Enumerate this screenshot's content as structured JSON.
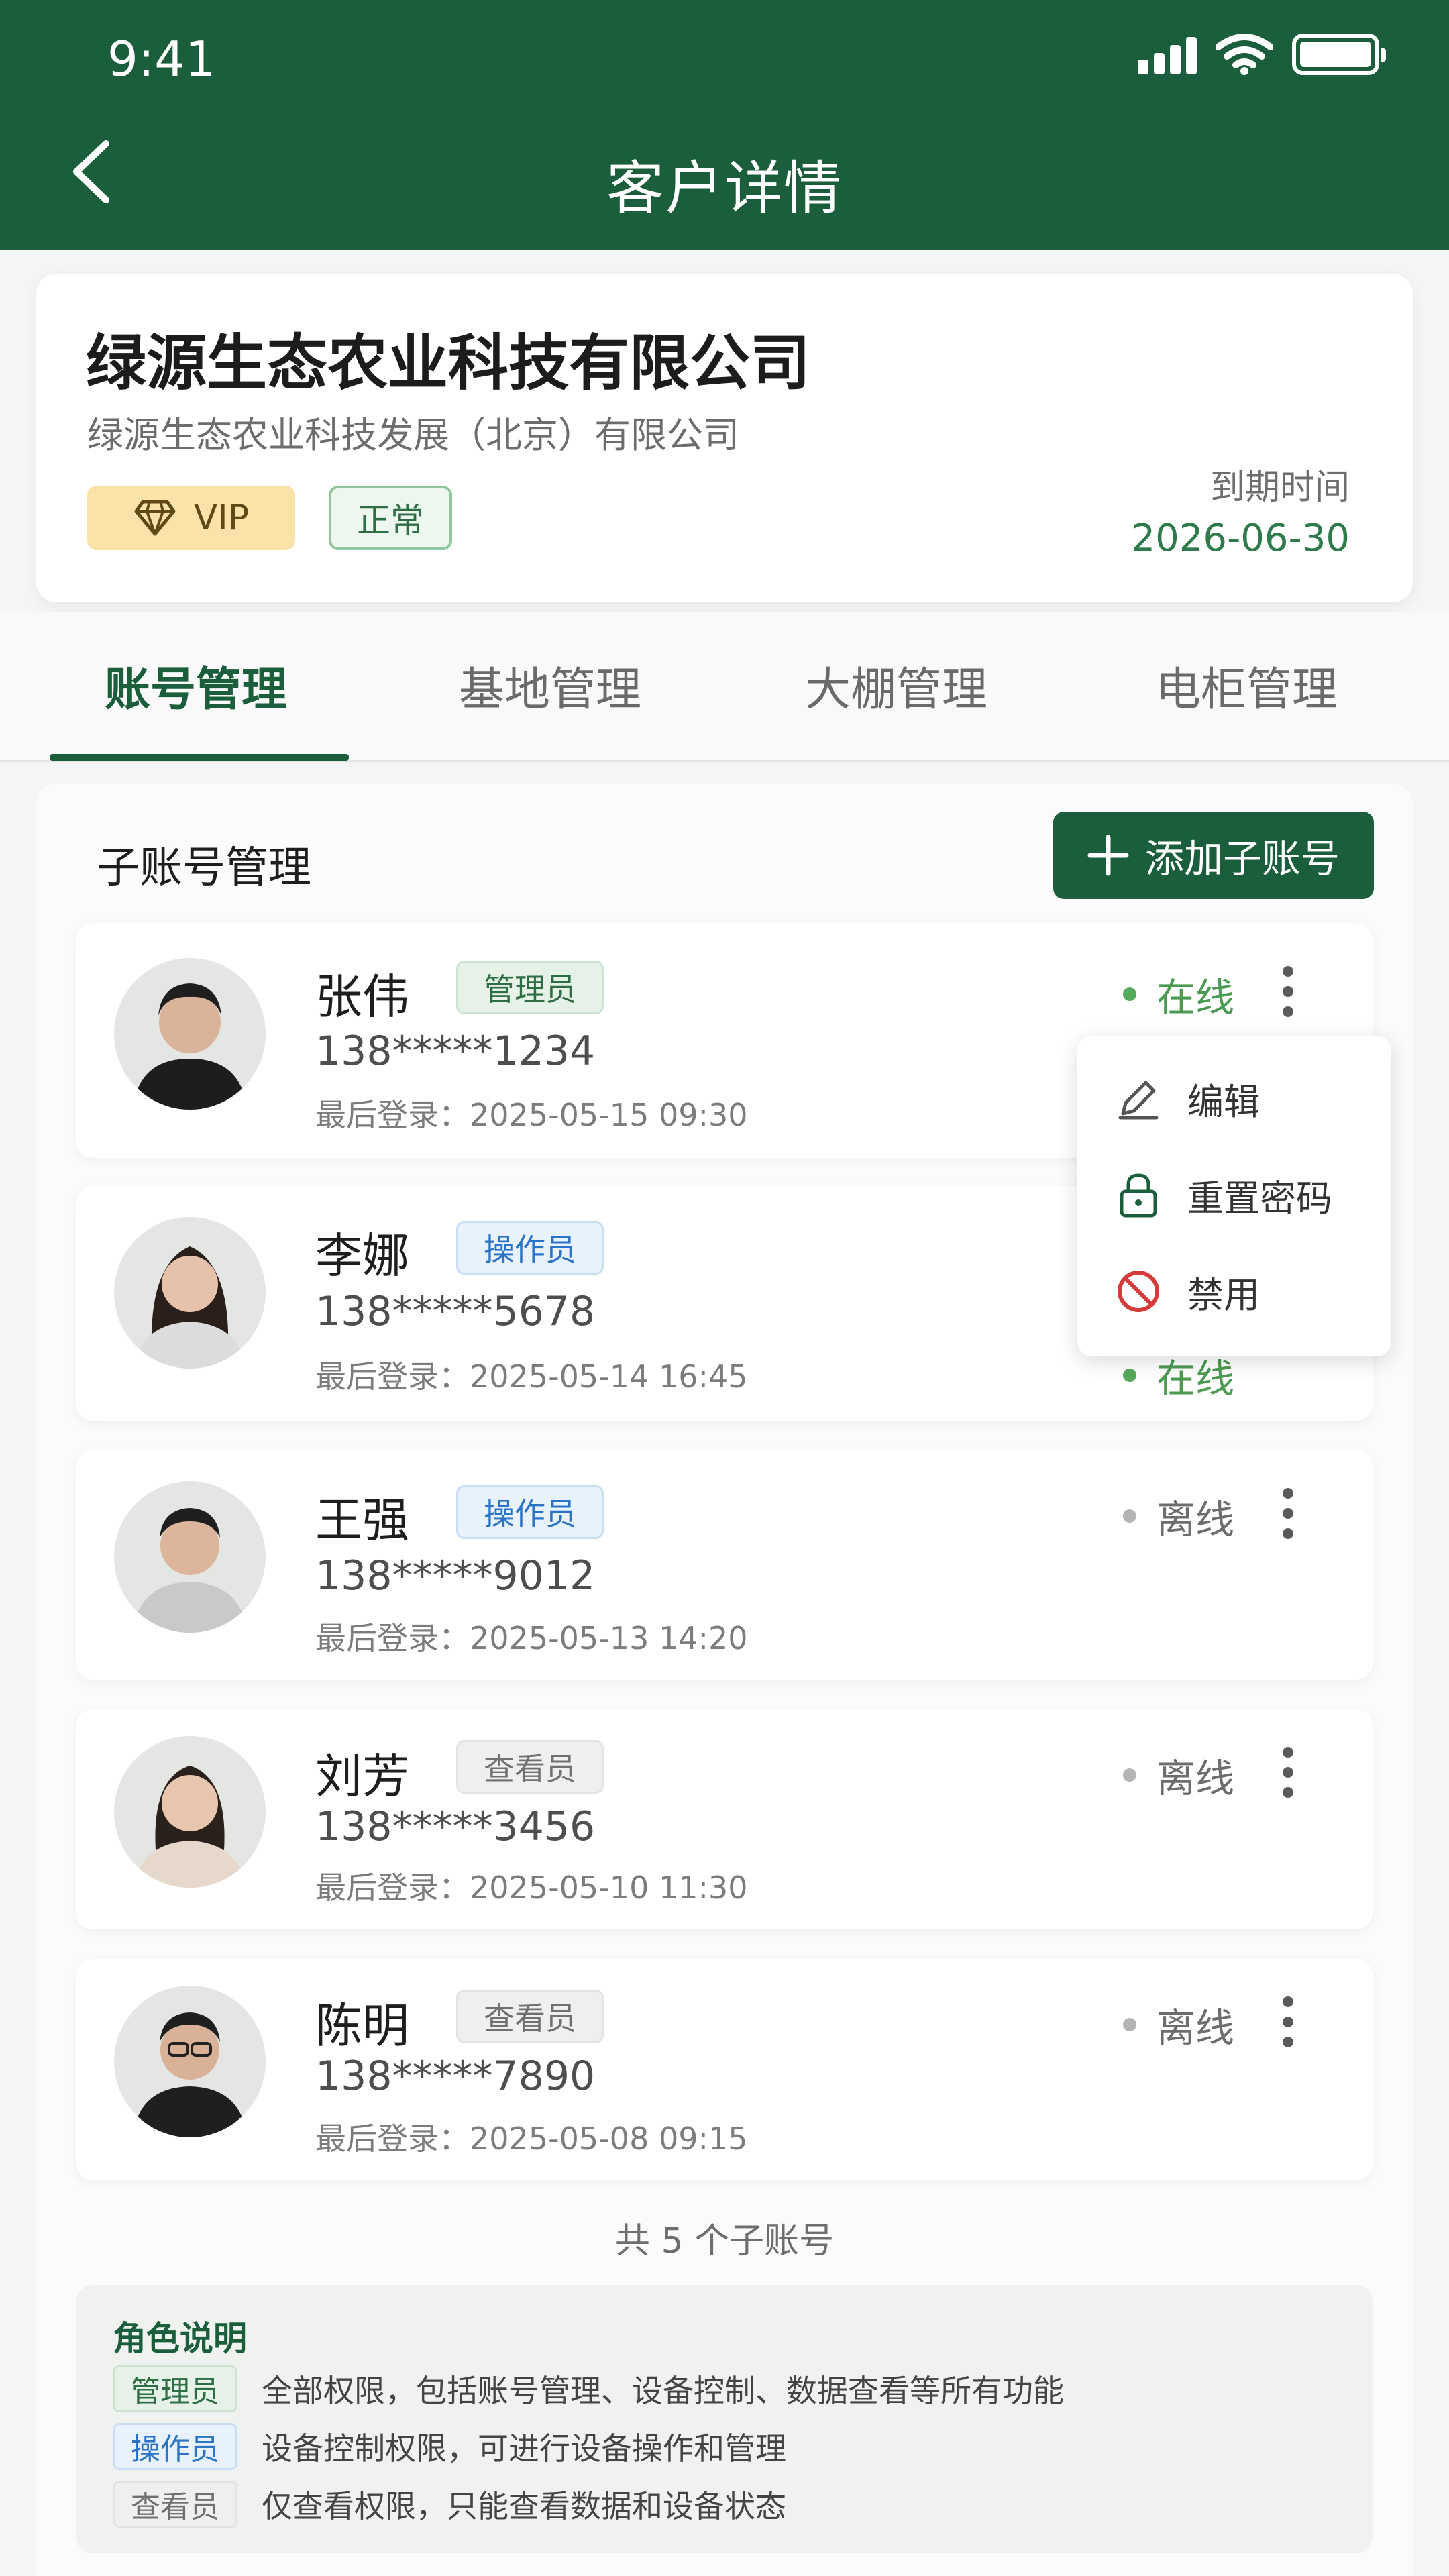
{
  "status_bar": {
    "time": "9:41"
  },
  "header": {
    "title": "客户详情"
  },
  "company": {
    "name": "绿源生态农业科技有限公司",
    "full_name": "绿源生态农业科技发展（北京）有限公司",
    "vip_label": "VIP",
    "status_label": "正常",
    "expire_label": "到期时间",
    "expire_date": "2026-06-30"
  },
  "tabs": [
    {
      "label": "账号管理",
      "active": true
    },
    {
      "label": "基地管理",
      "active": false
    },
    {
      "label": "大棚管理",
      "active": false
    },
    {
      "label": "电柜管理",
      "active": false
    }
  ],
  "section": {
    "title": "子账号管理",
    "add_button": "添加子账号"
  },
  "users": [
    {
      "name": "张伟",
      "role": "管理员",
      "role_type": "admin",
      "phone": "138*****1234",
      "last_login": "最后登录：2025-05-15  09:30",
      "status": "在线"
    },
    {
      "name": "李娜",
      "role": "操作员",
      "role_type": "op",
      "phone": "138*****5678",
      "last_login": "最后登录：2025-05-14  16:45",
      "status": "在线"
    },
    {
      "name": "王强",
      "role": "操作员",
      "role_type": "op",
      "phone": "138*****9012",
      "last_login": "最后登录：2025-05-13  14:20",
      "status": "离线"
    },
    {
      "name": "刘芳",
      "role": "查看员",
      "role_type": "view",
      "phone": "138*****3456",
      "last_login": "最后登录：2025-05-10  11:30",
      "status": "离线"
    },
    {
      "name": "陈明",
      "role": "查看员",
      "role_type": "view",
      "phone": "138*****7890",
      "last_login": "最后登录：2025-05-08  09:15",
      "status": "离线"
    }
  ],
  "menu": {
    "items": [
      {
        "label": "编辑",
        "icon": "edit-icon"
      },
      {
        "label": "重置密码",
        "icon": "lock-icon"
      },
      {
        "label": "禁用",
        "icon": "ban-icon"
      }
    ]
  },
  "total": "共 5 个子账号",
  "legend": {
    "title": "角色说明",
    "rows": [
      {
        "tag": "管理员",
        "desc": "全部权限，包括账号管理、设备控制、数据查看等所有功能"
      },
      {
        "tag": "操作员",
        "desc": "设备控制权限，可进行设备操作和管理"
      },
      {
        "tag": "查看员",
        "desc": "仅查看权限，只能查看数据和设备状态"
      }
    ]
  },
  "colors": {
    "brand": "#1b5e3b",
    "online": "#4c9a52",
    "offline": "#b4b4b4",
    "vip_bg": "#fbe2a9"
  }
}
